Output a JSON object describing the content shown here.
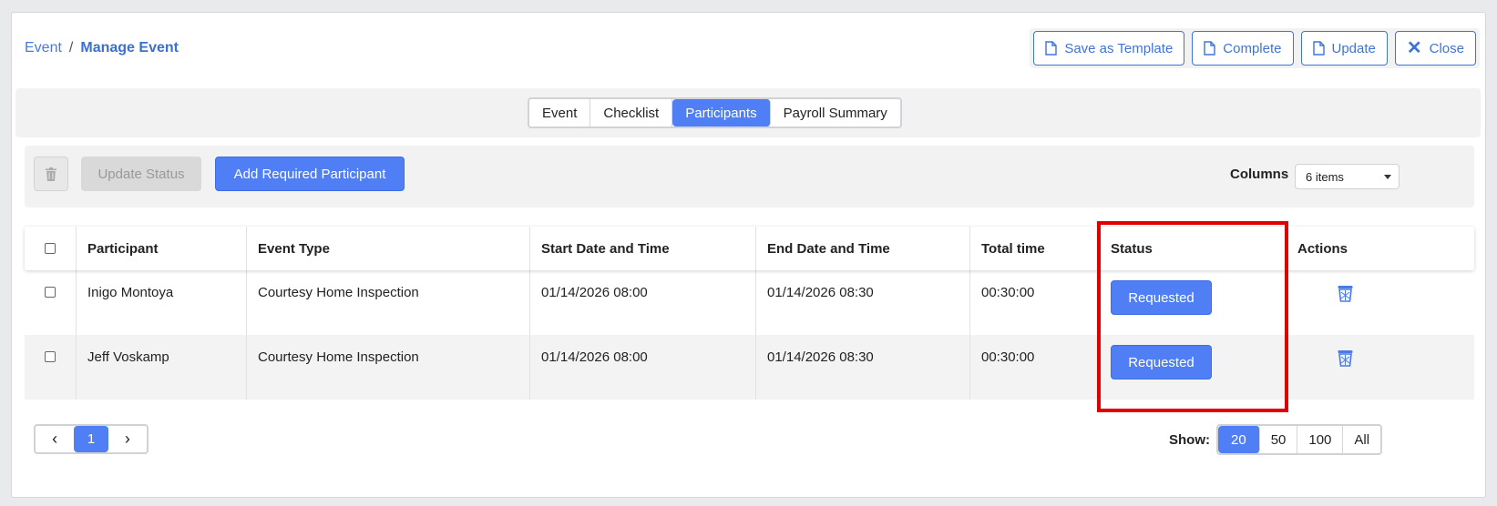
{
  "breadcrumb": {
    "parent": "Event",
    "separator": "/",
    "current": "Manage Event"
  },
  "header_buttons": {
    "save_template": "Save as Template",
    "complete": "Complete",
    "update": "Update",
    "close": "Close"
  },
  "tabs": [
    {
      "label": "Event",
      "active": false
    },
    {
      "label": "Checklist",
      "active": false
    },
    {
      "label": "Participants",
      "active": true
    },
    {
      "label": "Payroll Summary",
      "active": false
    }
  ],
  "toolbar": {
    "update_status": "Update Status",
    "add_participant": "Add Required Participant",
    "columns_label": "Columns",
    "columns_value": "6 items"
  },
  "table": {
    "headers": [
      "Participant",
      "Event Type",
      "Start Date and Time",
      "End Date and Time",
      "Total time",
      "Status",
      "Actions"
    ],
    "rows": [
      {
        "participant": "Inigo Montoya",
        "event_type": "Courtesy Home Inspection",
        "start": "01/14/2026 08:00",
        "end": "01/14/2026 08:30",
        "total": "00:30:00",
        "status": "Requested"
      },
      {
        "participant": "Jeff Voskamp",
        "event_type": "Courtesy Home Inspection",
        "start": "01/14/2026 08:00",
        "end": "01/14/2026 08:30",
        "total": "00:30:00",
        "status": "Requested"
      }
    ]
  },
  "pagination": {
    "current_page": "1",
    "show_label": "Show:",
    "show_options": [
      "20",
      "50",
      "100",
      "All"
    ],
    "show_selected": "20"
  },
  "colors": {
    "accent": "#4f7ef5",
    "link": "#3f73d8",
    "highlight": "#e00000"
  }
}
